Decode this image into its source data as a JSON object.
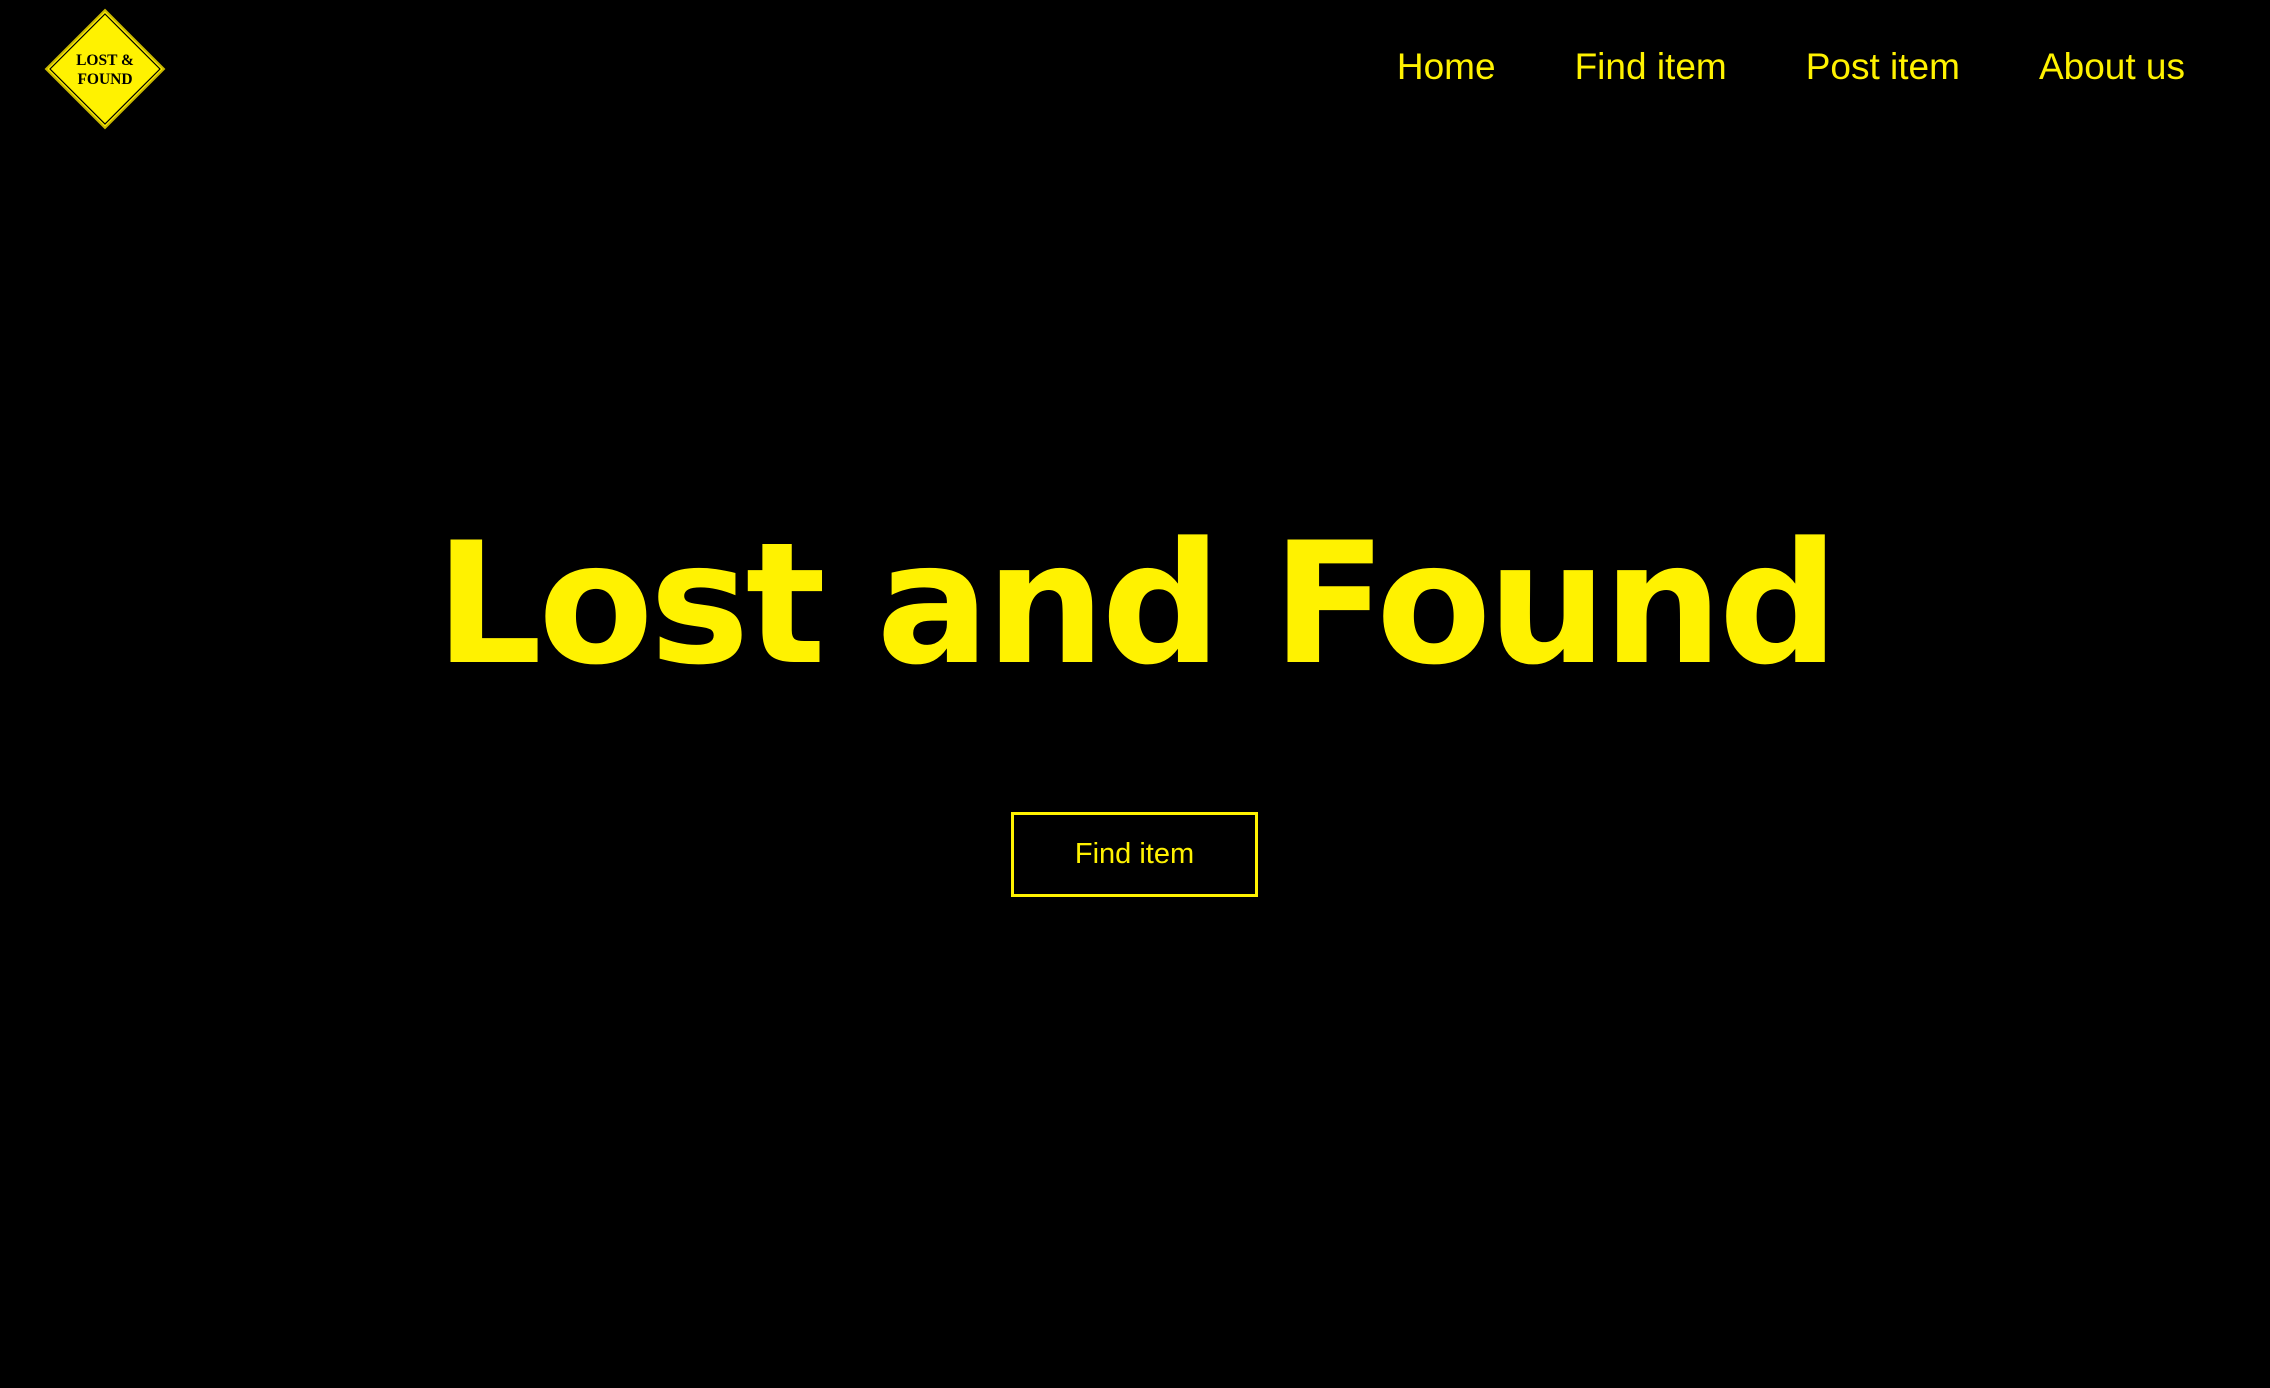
{
  "logo": {
    "line1": "LOST &",
    "line2": "FOUND"
  },
  "nav": {
    "items": [
      {
        "label": "Home"
      },
      {
        "label": "Find item"
      },
      {
        "label": "Post item"
      },
      {
        "label": "About us"
      }
    ]
  },
  "hero": {
    "title": "Lost and Found",
    "button_label": "Find item"
  },
  "colors": {
    "background": "#000000",
    "accent": "#FFF200"
  }
}
